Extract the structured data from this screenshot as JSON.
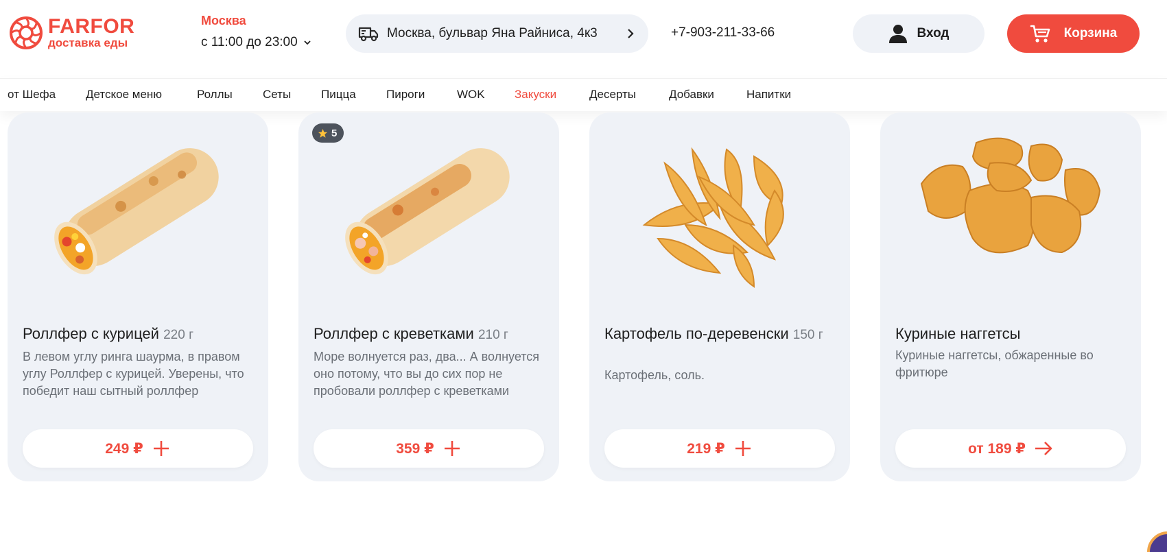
{
  "header": {
    "logo": {
      "brand": "FARFOR",
      "subtitle": "доставка еды"
    },
    "city": "Москва",
    "hours": "с 11:00 до 23:00",
    "address": "Москва, бульвар Яна Райниса, 4к3",
    "phone": "+7-903-211-33-66",
    "login_label": "Вход",
    "cart_label": "Корзина"
  },
  "nav": {
    "active": "Закуски",
    "items": [
      "от Шефа",
      "Детское меню",
      "Роллы",
      "Сеты",
      "Пицца",
      "Пироги",
      "WOK",
      "Закуски",
      "Десерты",
      "Добавки",
      "Напитки"
    ]
  },
  "products": [
    {
      "title": "Роллфер с курицей",
      "weight": "220 г",
      "description": "В левом углу ринга шаурма, в правом углу Роллфер с курицей. Уверены, что победит наш сытный роллфер",
      "price": "249 ₽",
      "action": "plus-icon"
    },
    {
      "title": "Роллфер с креветками",
      "weight": "210 г",
      "description": "Море волнуется раз, два... А волнуется оно потому, что вы до сих пор не пробовали роллфер с креветками",
      "price": "359 ₽",
      "action": "plus-icon",
      "rating": "5"
    },
    {
      "title": "Картофель по-деревенски",
      "weight": "150 г",
      "description": "Картофель, соль.",
      "price": "219 ₽",
      "action": "plus-icon"
    },
    {
      "title": "Куриные наггетсы",
      "weight": "",
      "description": "Куриные наггетсы, обжаренные во фритюре",
      "price": "от 189 ₽",
      "action": "arrow-right-icon"
    }
  ],
  "colors": {
    "accent": "#f04b3e",
    "card_bg": "#eff2f7",
    "text": "#1f1f1f",
    "muted": "#6b7077",
    "badge_bg": "#4d535c"
  }
}
